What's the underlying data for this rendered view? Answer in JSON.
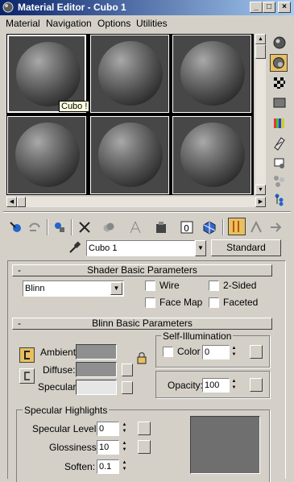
{
  "window": {
    "title": "Material Editor - Cubo 1",
    "minimize": "_",
    "maximize": "□",
    "close": "×"
  },
  "menu": [
    "Material",
    "Navigation",
    "Options",
    "Utilities"
  ],
  "slots": {
    "tooltip": "Cubo !"
  },
  "side_toolbar": [
    "sample-type-sphere-icon",
    "backlight-icon",
    "background-checker-icon",
    "sample-uv-tiling-icon",
    "video-color-check-icon",
    "make-preview-icon",
    "options-icon",
    "select-by-material-icon",
    "material-map-navigator-icon"
  ],
  "bottom_toolbar": [
    "get-material-icon",
    "put-to-scene-icon",
    "assign-to-selection-icon",
    "reset-icon",
    "make-copy-icon",
    "make-unique-icon",
    "put-to-library-icon",
    "material-effects-channel-icon",
    "show-map-in-viewport-icon",
    "show-end-result-icon",
    "go-to-parent-icon",
    "go-forward-icon"
  ],
  "material": {
    "name": "Cubo 1",
    "type": "Standard"
  },
  "shader_basic": {
    "header": "Shader Basic Parameters",
    "collapse": "-",
    "shader": "Blinn",
    "wire": "Wire",
    "two_sided": "2-Sided",
    "face_map": "Face Map",
    "faceted": "Faceted"
  },
  "blinn_basic": {
    "header": "Blinn Basic Parameters",
    "collapse": "-",
    "ambient": "Ambient:",
    "diffuse": "Diffuse:",
    "specular": "Specular:",
    "self_illum": "Self-Illumination",
    "color_label": "Color",
    "color_value": "0",
    "opacity_label": "Opacity:",
    "opacity_value": "100",
    "spec_highlights": "Specular Highlights",
    "spec_level_label": "Specular Level:",
    "spec_level_value": "0",
    "glossiness_label": "Glossiness:",
    "glossiness_value": "10",
    "soften_label": "Soften:",
    "soften_value": "0.1"
  },
  "colors": {
    "ambient": "#8f8f8f",
    "diffuse": "#8f8f8f",
    "specular": "#e6e6e6",
    "highlight_preview": "#6f6f6f"
  }
}
